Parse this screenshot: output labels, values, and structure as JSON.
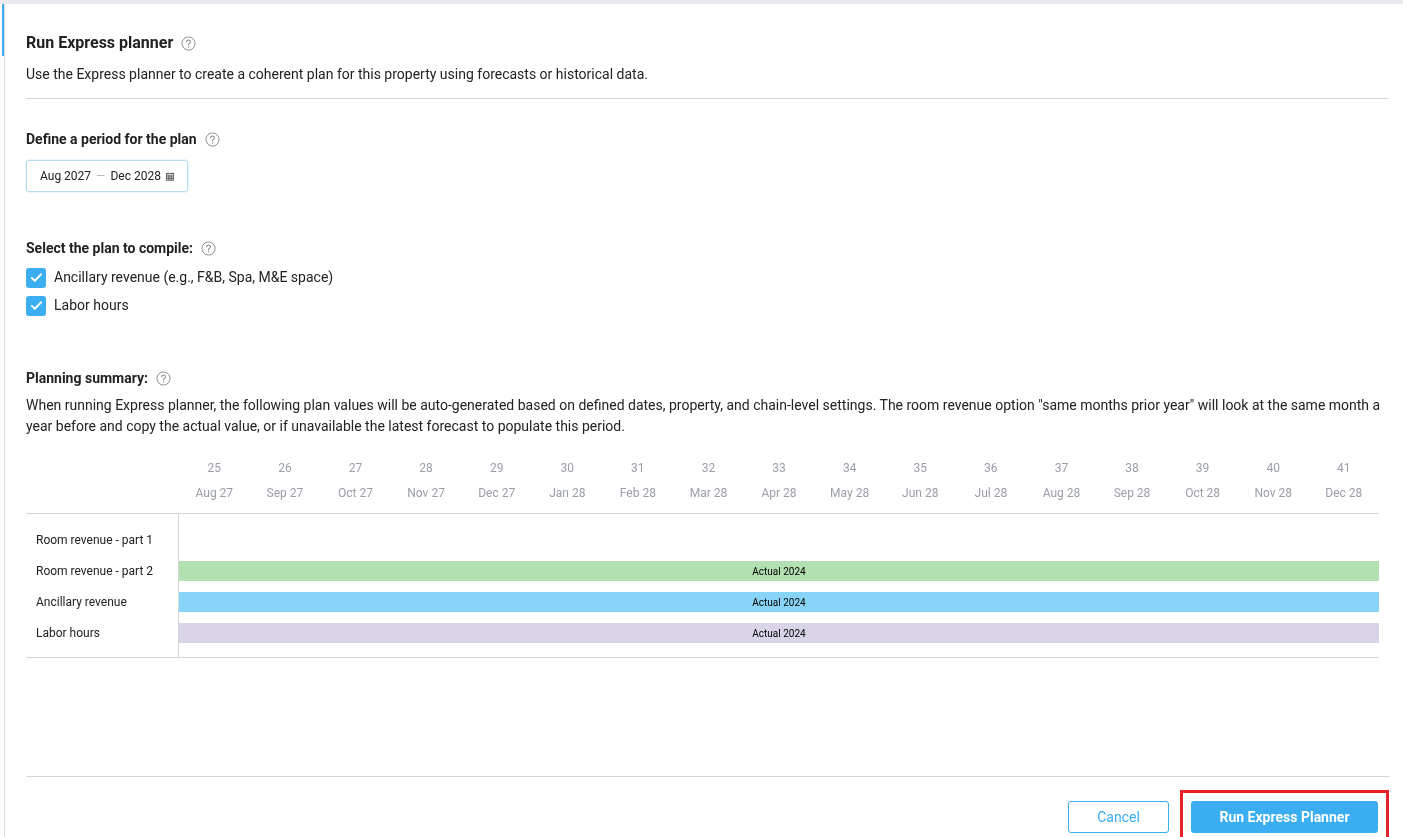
{
  "header": {
    "title": "Run Express planner",
    "description": "Use the Express planner to create a coherent plan for this property using forecasts or historical data."
  },
  "period": {
    "label": "Define a period for the plan",
    "start": "Aug 2027",
    "separator": "—",
    "end": "Dec 2028"
  },
  "compile": {
    "label": "Select the plan to compile:",
    "options": [
      {
        "label": "Ancillary revenue (e.g., F&B, Spa, M&E space)",
        "checked": true
      },
      {
        "label": "Labor hours",
        "checked": true
      }
    ]
  },
  "summary": {
    "label": "Planning summary:",
    "description": "When running Express planner, the following plan values will be auto-generated based on defined dates, property, and chain-level settings. The room revenue option \"same months prior year\" will look at the same month a year before and copy the actual value, or if unavailable the latest forecast to populate this period.",
    "periods": [
      {
        "number": "25",
        "month": "Aug 27"
      },
      {
        "number": "26",
        "month": "Sep 27"
      },
      {
        "number": "27",
        "month": "Oct 27"
      },
      {
        "number": "28",
        "month": "Nov 27"
      },
      {
        "number": "29",
        "month": "Dec 27"
      },
      {
        "number": "30",
        "month": "Jan 28"
      },
      {
        "number": "31",
        "month": "Feb 28"
      },
      {
        "number": "32",
        "month": "Mar 28"
      },
      {
        "number": "33",
        "month": "Apr 28"
      },
      {
        "number": "34",
        "month": "May 28"
      },
      {
        "number": "35",
        "month": "Jun 28"
      },
      {
        "number": "36",
        "month": "Jul 28"
      },
      {
        "number": "37",
        "month": "Aug 28"
      },
      {
        "number": "38",
        "month": "Sep 28"
      },
      {
        "number": "39",
        "month": "Oct 28"
      },
      {
        "number": "40",
        "month": "Nov 28"
      },
      {
        "number": "41",
        "month": "Dec 28"
      }
    ],
    "rows": [
      {
        "label": "Room revenue - part 1"
      },
      {
        "label": "Room revenue - part 2",
        "bar": {
          "text": "Actual 2024",
          "color": "#b3e0b0"
        }
      },
      {
        "label": "Ancillary revenue",
        "bar": {
          "text": "Actual 2024",
          "color": "#88d4f8"
        }
      },
      {
        "label": "Labor hours",
        "bar": {
          "text": "Actual 2024",
          "color": "#d9d4e8"
        }
      }
    ]
  },
  "actions": [
    {
      "label": "Cancel",
      "kind": "secondary",
      "highlighted": false
    },
    {
      "label": "Run Express Planner",
      "kind": "primary",
      "highlighted": true
    }
  ]
}
